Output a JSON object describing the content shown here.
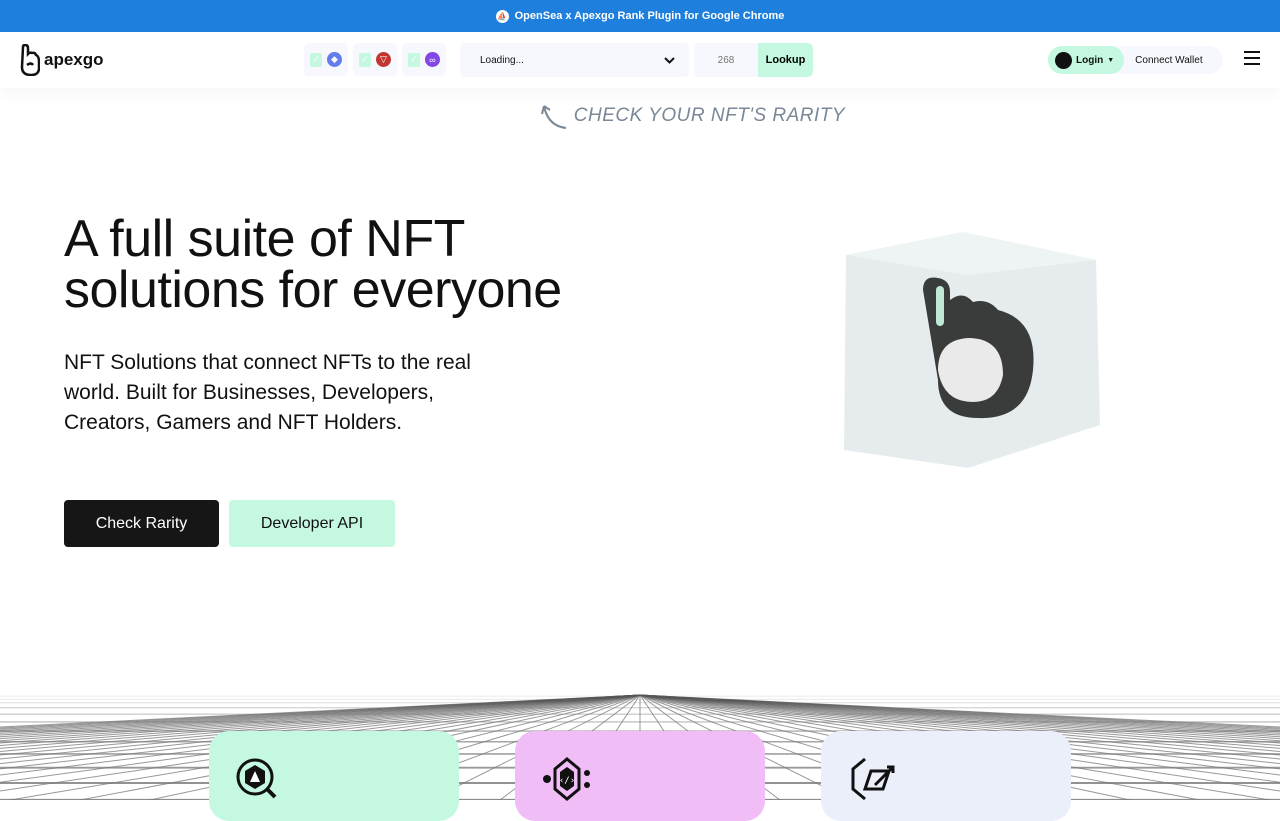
{
  "banner": {
    "text": "OpenSea x Apexgo Rank Plugin for Google Chrome",
    "icon": "opensea-icon"
  },
  "nav": {
    "logo": "apexgo",
    "chains": [
      {
        "name": "ethereum",
        "color": "#627eea"
      },
      {
        "name": "tron",
        "color": "#c23631"
      },
      {
        "name": "polygon",
        "color": "#8247e5"
      }
    ],
    "collection_select": "Loading...",
    "token_id_placeholder": "268",
    "lookup": "Lookup",
    "login": "Login",
    "connect_wallet": "Connect Wallet"
  },
  "hero": {
    "hint": "CHECK YOUR NFT'S RARITY",
    "title": "A full suite of NFT solutions for everyone",
    "subtitle": "NFT Solutions that connect NFTs to the real world. Built for Businesses, Developers, Creators, Gamers and NFT Holders.",
    "primary_button": "Check Rarity",
    "secondary_button": "Developer API"
  },
  "cards": [
    {
      "color": "#c4f8e0",
      "icon": "rarity-search-icon"
    },
    {
      "color": "#f1bdf7",
      "icon": "api-code-icon"
    },
    {
      "color": "#ebeffa",
      "icon": "creator-tools-icon"
    }
  ]
}
